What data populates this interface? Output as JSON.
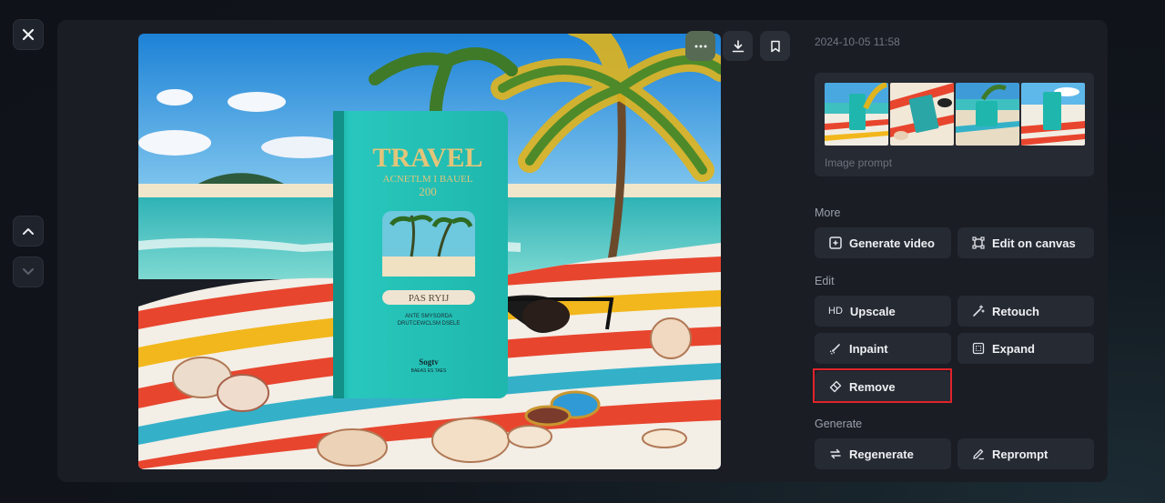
{
  "timestamp": "2024-10-05 11:58",
  "prompt_card": {
    "label": "Image prompt"
  },
  "main_image": {
    "book": {
      "title": "TRAVEL",
      "subtitle": "ACNETLM I BAUEL",
      "number": "200",
      "passport": "PAS   RYIJ",
      "small_text_1": "ANTE SMYSORDA",
      "small_text_2": "DRUTCEWCLSM DSELE",
      "footer": "Sogtv",
      "footer_small": "BAEAS ES TAES"
    }
  },
  "sections": {
    "more": "More",
    "edit": "Edit",
    "generate": "Generate"
  },
  "buttons": {
    "generate_video": "Generate video",
    "edit_on_canvas": "Edit on canvas",
    "upscale": "Upscale",
    "upscale_prefix": "HD",
    "retouch": "Retouch",
    "inpaint": "Inpaint",
    "expand": "Expand",
    "remove": "Remove",
    "regenerate": "Regenerate",
    "reprompt": "Reprompt"
  },
  "colors": {
    "panel": "#1a1d24",
    "button": "#262a33",
    "highlight": "#e0242a",
    "accent_more": "#566a54"
  }
}
